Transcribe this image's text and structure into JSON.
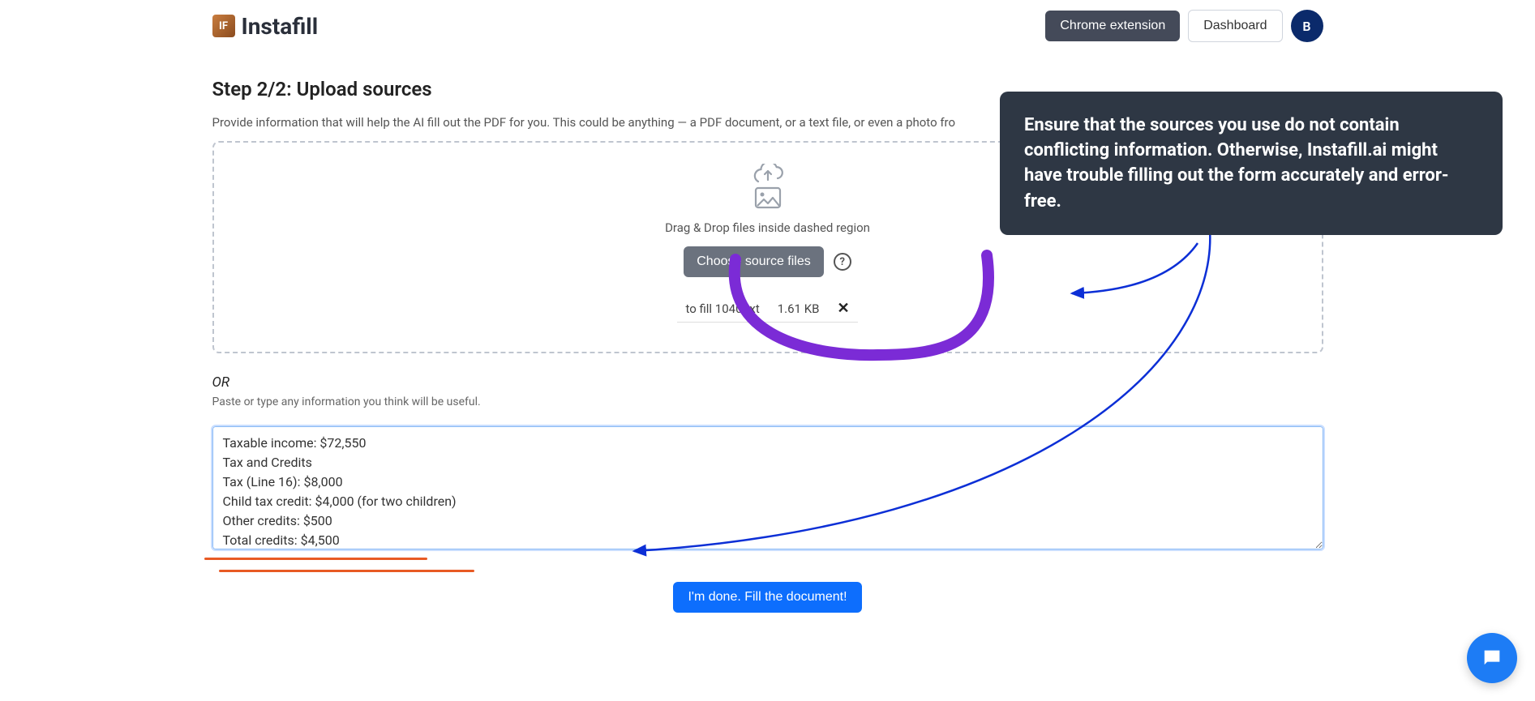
{
  "header": {
    "logo_text": "Instafill",
    "chrome_btn": "Chrome extension",
    "dashboard_btn": "Dashboard",
    "avatar_initial": "B"
  },
  "page": {
    "title": "Step 2/2: Upload sources",
    "subtitle": "Provide information that will help the AI fill out the PDF for you. This could be anything — a PDF document, or a text file, or even a photo fro"
  },
  "dropzone": {
    "hint": "Drag & Drop files inside dashed region",
    "choose_label": "Choose source files",
    "file_name": "to fill 1040.txt",
    "file_size": "1.61 KB"
  },
  "or_label": "OR",
  "paste_label": "Paste or type any information you think will be useful.",
  "textarea_value": "Taxable income: $72,550\nTax and Credits\nTax (Line 16): $8,000\nChild tax credit: $4,000 (for two children)\nOther credits: $500\nTotal credits: $4,500",
  "fill_button": "I'm done. Fill the document!",
  "tip_text": "Ensure that the sources you use do not contain conflicting information. Otherwise, Instafill.ai might have trouble filling out the form accurately and error-free."
}
